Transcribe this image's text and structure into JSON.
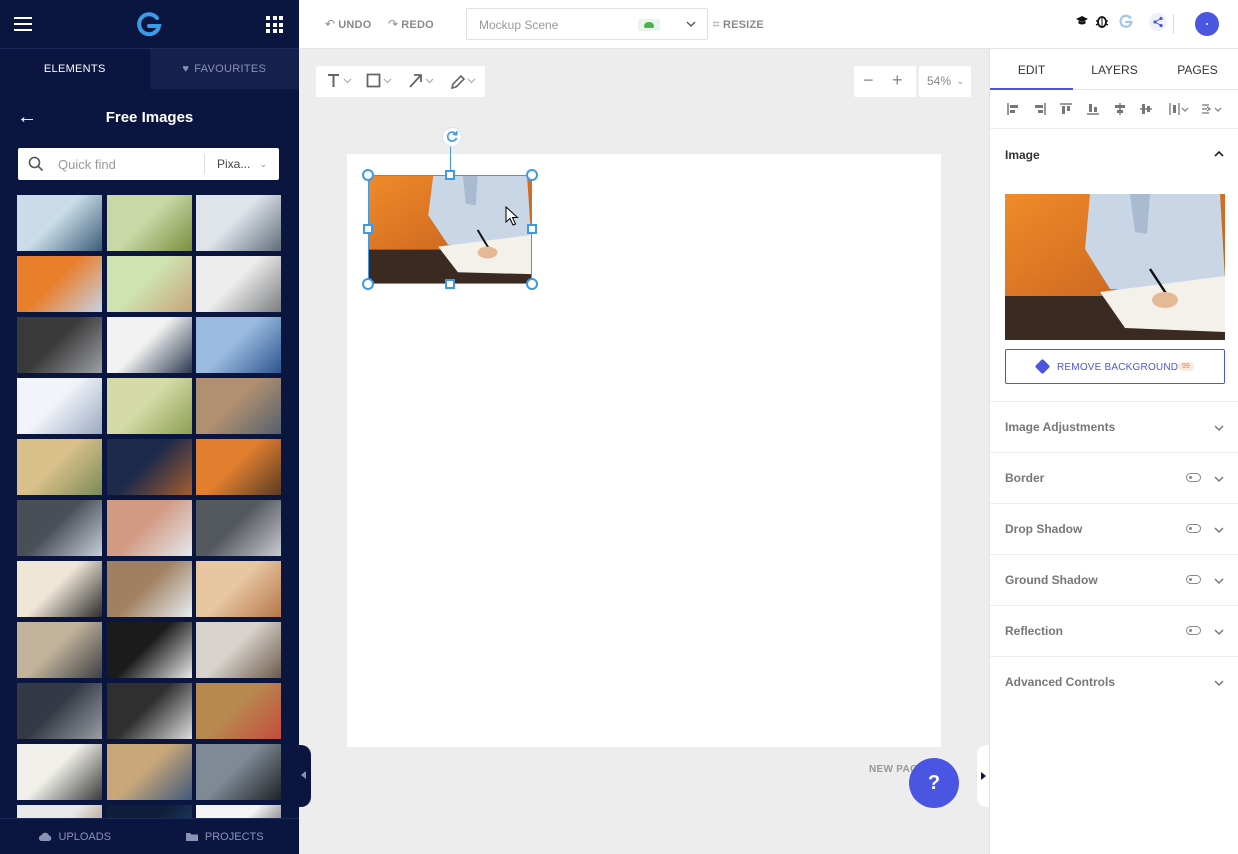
{
  "left_panel": {
    "tabs": {
      "elements": "ELEMENTS",
      "favourites": "FAVOURITES"
    },
    "title": "Free Images",
    "search": {
      "placeholder": "Quick find",
      "source": "Pixa..."
    },
    "bottom": {
      "uploads": "UPLOADS",
      "projects": "PROJECTS"
    },
    "thumbnails": [
      {
        "name": "phone-in-hand",
        "c1": "#c9dce8",
        "c2": "#3c5e78"
      },
      {
        "name": "plants-on-coins",
        "c1": "#c8d9a6",
        "c2": "#7a8f3e"
      },
      {
        "name": "man-at-whiteboard",
        "c1": "#dfe4ea",
        "c2": "#5f6d7a"
      },
      {
        "name": "man-writing-orange",
        "c1": "#e97f2b",
        "c2": "#c5d3e2"
      },
      {
        "name": "alarm-clock",
        "c1": "#cfe3b0",
        "c2": "#c7a47a"
      },
      {
        "name": "office-interior",
        "c1": "#ededed",
        "c2": "#7b7d80"
      },
      {
        "name": "laptop-dark",
        "c1": "#3a3a3a",
        "c2": "#9ea1a5"
      },
      {
        "name": "businessman-portrait",
        "c1": "#f2f2f2",
        "c2": "#2b3a4f"
      },
      {
        "name": "glass-building",
        "c1": "#9bbbe0",
        "c2": "#2d5590"
      },
      {
        "name": "laptop-typing",
        "c1": "#f1f4f8",
        "c2": "#9aa9c2"
      },
      {
        "name": "coin-jars",
        "c1": "#d4dba6",
        "c2": "#8e9f52"
      },
      {
        "name": "hands-on-laptop",
        "c1": "#b09070",
        "c2": "#55606e"
      },
      {
        "name": "supermarket-shelf",
        "c1": "#d9c08a",
        "c2": "#7a8a57"
      },
      {
        "name": "city-night",
        "c1": "#1e2a4a",
        "c2": "#a35d2e"
      },
      {
        "name": "desk-orange-wall",
        "c1": "#e3802f",
        "c2": "#5a3b26"
      },
      {
        "name": "laptop-screen",
        "c1": "#4a4f57",
        "c2": "#c6ced8"
      },
      {
        "name": "woman-laptop-brick",
        "c1": "#d29a83",
        "c2": "#e4e8ec"
      },
      {
        "name": "server-room",
        "c1": "#54595f",
        "c2": "#c8cbcf"
      },
      {
        "name": "laptop-on-desk",
        "c1": "#efe6d6",
        "c2": "#2e2e2e"
      },
      {
        "name": "desk-top-view",
        "c1": "#a08060",
        "c2": "#e8eef2"
      },
      {
        "name": "hands-phone-table",
        "c1": "#e6c7a2",
        "c2": "#b7764a"
      },
      {
        "name": "meeting-table",
        "c1": "#c2b49b",
        "c2": "#3d3f44"
      },
      {
        "name": "presentation-screen",
        "c1": "#1b1b1b",
        "c2": "#e8e8e8"
      },
      {
        "name": "hands-tablet",
        "c1": "#d8d3cc",
        "c2": "#6c5a4b"
      },
      {
        "name": "phone-dark-suit",
        "c1": "#343a45",
        "c2": "#9a9ea4"
      },
      {
        "name": "paperwork",
        "c1": "#2f2f2f",
        "c2": "#dddddd"
      },
      {
        "name": "market-food",
        "c1": "#b7894f",
        "c2": "#c64b3f"
      },
      {
        "name": "team-hands",
        "c1": "#f0efe9",
        "c2": "#3b3b3b"
      },
      {
        "name": "man-thinking",
        "c1": "#c8a779",
        "c2": "#405a7a"
      },
      {
        "name": "silhouette-window",
        "c1": "#7f8a95",
        "c2": "#1f2226"
      },
      {
        "name": "speaker-stage",
        "c1": "#e9e9e9",
        "c2": "#8c6a4a"
      },
      {
        "name": "earth-night",
        "c1": "#0f1f3a",
        "c2": "#2c4d7a"
      },
      {
        "name": "people-silhouettes",
        "c1": "#f5f5f5",
        "c2": "#222222"
      }
    ]
  },
  "topbar": {
    "undo": "UNDO",
    "redo": "REDO",
    "scene_name": "Mockup Scene",
    "resize": "RESIZE"
  },
  "canvas": {
    "zoom": "54%",
    "new_page": "NEW PAGE",
    "help": "?"
  },
  "right_panel": {
    "tabs": {
      "edit": "EDIT",
      "layers": "LAYERS",
      "pages": "PAGES"
    },
    "image_section": "Image",
    "remove_background": "REMOVE BACKGROUND",
    "remove_bg_count": "99",
    "sections": {
      "image_adjustments": "Image Adjustments",
      "border": "Border",
      "drop_shadow": "Drop Shadow",
      "ground_shadow": "Ground Shadow",
      "reflection": "Reflection",
      "advanced_controls": "Advanced Controls"
    }
  },
  "colors": {
    "sidebar_bg": "#0b1640",
    "accent": "#4a56e2",
    "selection": "#3d9ae6"
  }
}
